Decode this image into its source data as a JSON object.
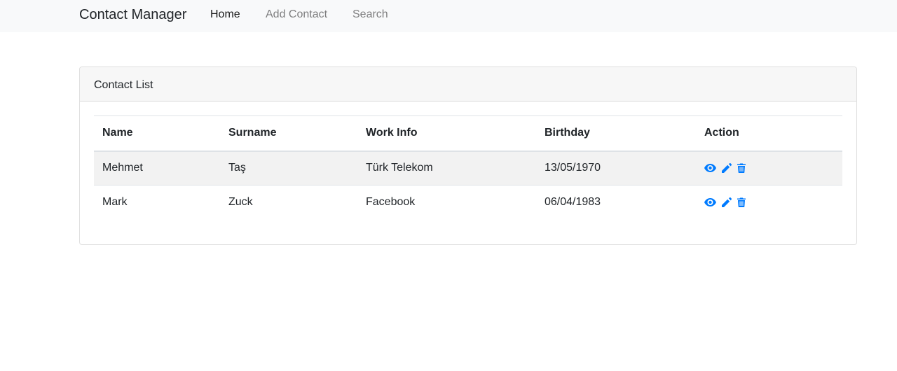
{
  "navbar": {
    "brand": "Contact Manager",
    "links": [
      {
        "label": "Home",
        "active": true
      },
      {
        "label": "Add Contact",
        "active": false
      },
      {
        "label": "Search",
        "active": false
      }
    ]
  },
  "card": {
    "title": "Contact List"
  },
  "table": {
    "headers": [
      "Name",
      "Surname",
      "Work Info",
      "Birthday",
      "Action"
    ],
    "rows": [
      {
        "name": "Mehmet",
        "surname": "Taş",
        "work": "Türk Telekom",
        "birthday": "13/05/1970",
        "actions": [
          "eye-icon",
          "pencil-icon",
          "trash-icon"
        ]
      },
      {
        "name": "Mark",
        "surname": "Zuck",
        "work": "Facebook",
        "birthday": "06/04/1983",
        "actions": [
          "eye-icon",
          "pencil-icon",
          "trash-icon"
        ]
      }
    ]
  },
  "colors": {
    "navbar_bg": "#f8f9fa",
    "icon_accent": "#007bff",
    "striped_row": "#f2f2f2"
  }
}
